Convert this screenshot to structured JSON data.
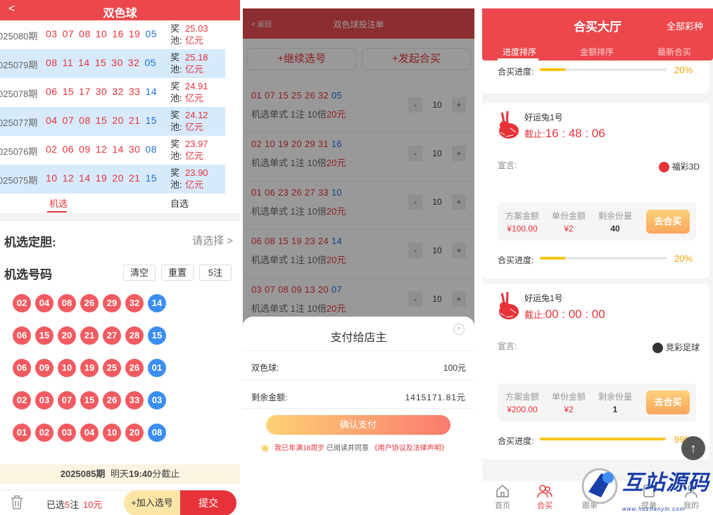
{
  "p1": {
    "back": "<",
    "title": "双色球",
    "history": [
      {
        "issue": "025080期",
        "reds": [
          "03",
          "07",
          "08",
          "10",
          "16",
          "19"
        ],
        "blue": "05",
        "pool_label": "奖池:",
        "pool_amount": "25.03",
        "pool_unit": "亿元"
      },
      {
        "issue": "025079期",
        "reds": [
          "08",
          "11",
          "14",
          "15",
          "30",
          "32"
        ],
        "blue": "05",
        "pool_label": "奖池:",
        "pool_amount": "25.18",
        "pool_unit": "亿元"
      },
      {
        "issue": "025078期",
        "reds": [
          "06",
          "15",
          "17",
          "30",
          "32",
          "33"
        ],
        "blue": "14",
        "pool_label": "奖池:",
        "pool_amount": "24.91",
        "pool_unit": "亿元"
      },
      {
        "issue": "025077期",
        "reds": [
          "04",
          "07",
          "08",
          "15",
          "20",
          "21"
        ],
        "blue": "15",
        "pool_label": "奖池:",
        "pool_amount": "24.12",
        "pool_unit": "亿元"
      },
      {
        "issue": "025076期",
        "reds": [
          "02",
          "06",
          "09",
          "12",
          "14",
          "30"
        ],
        "blue": "08",
        "pool_label": "奖池:",
        "pool_amount": "23.97",
        "pool_unit": "亿元"
      },
      {
        "issue": "025075期",
        "reds": [
          "10",
          "12",
          "14",
          "19",
          "20",
          "21"
        ],
        "blue": "15",
        "pool_label": "奖池:",
        "pool_amount": "23.90",
        "pool_unit": "亿元"
      }
    ],
    "tab_machine": "机选",
    "tab_self": "自选",
    "dan_label": "机选定胆:",
    "dan_choose": "请选择 >",
    "haoma_label": "机选号码",
    "btn_clear": "清空",
    "btn_reset": "重置",
    "btn_count": "5注",
    "picks": [
      {
        "reds": [
          "02",
          "04",
          "08",
          "26",
          "29",
          "32"
        ],
        "blue": "14"
      },
      {
        "reds": [
          "06",
          "15",
          "20",
          "21",
          "27",
          "28"
        ],
        "blue": "15"
      },
      {
        "reds": [
          "06",
          "09",
          "10",
          "19",
          "25",
          "26"
        ],
        "blue": "01"
      },
      {
        "reds": [
          "02",
          "03",
          "07",
          "15",
          "26",
          "33"
        ],
        "blue": "03"
      },
      {
        "reds": [
          "01",
          "02",
          "03",
          "04",
          "10",
          "20"
        ],
        "blue": "08"
      }
    ],
    "deadline_issue": "2025085期",
    "deadline_pre": "明天",
    "deadline_time": "19:40",
    "deadline_post": "分截止",
    "sel_pre": "已选",
    "sel_count": "5",
    "sel_mid": "注",
    "sel_amount": "10元",
    "add_label": "+加入选号",
    "submit_label": "提交"
  },
  "p2": {
    "back": "< 返回",
    "title": "双色球投注单",
    "continue_label": "+继续选号",
    "group_label": "+发起合买",
    "tickets": [
      {
        "reds": "01 07 15 25 26 32",
        "blue": "05",
        "desc_pre": "机选单式 1注 10倍",
        "desc_amt": "20元",
        "multiple": "10"
      },
      {
        "reds": "02 10 19 20 29 31",
        "blue": "16",
        "desc_pre": "机选单式 1注 10倍",
        "desc_amt": "20元",
        "multiple": "10"
      },
      {
        "reds": "01 06 23 26 27 33",
        "blue": "10",
        "desc_pre": "机选单式 1注 10倍",
        "desc_amt": "20元",
        "multiple": "10"
      },
      {
        "reds": "06 08 15 19 23 24",
        "blue": "14",
        "desc_pre": "机选单式 1注 10倍",
        "desc_amt": "20元",
        "multiple": "10"
      },
      {
        "reds": "03 07 08 09 13 20",
        "blue": "07",
        "desc_pre": "机选单式 1注 10倍",
        "desc_amt": "20元",
        "multiple": "10"
      }
    ],
    "minus": "-",
    "plus": "+",
    "modal": {
      "title": "支付给店主",
      "close": "×",
      "row1_label": "双色球:",
      "row1_value": "100元",
      "row2_label": "剩余金额:",
      "row2_value": "1415171.81元",
      "pay_label": "确认支付",
      "agree_red": "我已年满18周岁",
      "agree_gray": " 已阅读并同意 ",
      "agree_link": "《用户协议及法律声明》"
    }
  },
  "p3": {
    "title": "合买大厅",
    "all_types": "全部彩种",
    "tabs": [
      "进度排序",
      "金额排序",
      "最新合买"
    ],
    "progress_label": "合买进度:",
    "top_pct": "20%",
    "top_progress": 0.2,
    "cards": [
      {
        "user": "好运兔1号",
        "cd_label": "截止:",
        "countdown": "16 : 48 : 06",
        "decl_label": "宣言:",
        "lottery": "福彩3D",
        "plan_label": "方案金额",
        "plan_value": "¥100.00",
        "unit_label": "单份金额",
        "unit_value": "¥2",
        "remain_label": "剩余份量",
        "remain_value": "40",
        "go_label": "去合买",
        "pct": "20%",
        "progress": 0.2
      },
      {
        "user": "好运兔1号",
        "cd_label": "截止:",
        "countdown": "00 : 00 : 00",
        "decl_label": "宣言:",
        "lottery": "竞彩足球",
        "plan_label": "方案金额",
        "plan_value": "¥200.00",
        "unit_label": "单份金额",
        "unit_value": "¥2",
        "remain_label": "剩余份量",
        "remain_value": "1",
        "go_label": "去合买",
        "pct": "99%",
        "progress": 0.99
      }
    ],
    "nav": [
      "首页",
      "合买",
      "跟单",
      "提单",
      "我的"
    ],
    "scrolltop": "↑"
  },
  "watermark": {
    "text": "互站源码",
    "url": "www.huzhanym.com"
  },
  "colors": {
    "accent": "#ec474c",
    "blue_ball": "#3c8ff0",
    "red_ball": "#f25a61",
    "progress": "#f7c500"
  }
}
